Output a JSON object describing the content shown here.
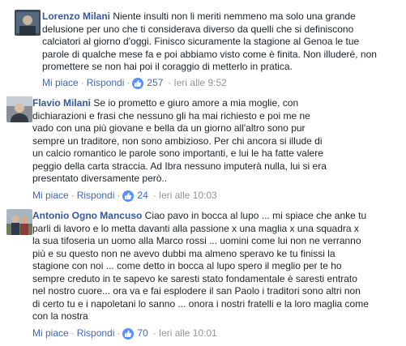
{
  "comments": [
    {
      "author": "Lorenzo Milani",
      "lines": [
        " Niente insulti non li meriti nemmeno ma solo una grande",
        "delusione per uno che ti considerava diverso da quelli che si definiscono",
        "calciatori al giorno d'oggi. Finisco sicuramente la stagione al Genoa le tue",
        "parole di qualche mese fa e poi abbiamo visto come è finita. Non illuderé, non",
        "promettere se non hai poi il coraggio di metterlo in pratica."
      ],
      "like_label": "Mi piace",
      "reply_label": "Rispondi",
      "reactions": "257",
      "time": "Ieri alle 9:52"
    },
    {
      "author": "Flavio Milani",
      "lines": [
        " Se io prometto e giuro amore a mia moglie, con",
        "dichiarazioni e frasi che nessuno gli ha mai richiesto e poi me ne",
        "vado con una più giovane e bella da un giorno all'altro sono pur",
        "sempre un traditore, non sono ambizioso. Per chi ancora si illude di",
        "un calcio romantico le parole sono importanti, e lui le ha fatte valere",
        "peggio della carta straccia. Ad Ibra nessuno imputerà nulla, lui si era",
        "presentato diversamente però.."
      ],
      "like_label": "Mi piace",
      "reply_label": "Rispondi",
      "reactions": "24",
      "time": "Ieri alle 10:03"
    },
    {
      "author": "Antonio Ogno Mancuso",
      "lines": [
        " Ciao pavo in bocca al lupo ... mi spiace che anke tu",
        "parli di lavoro e lo metta davanti alla passione x una maglia x una squadra x",
        "la sua tifoseria un uomo alla Marco rossi ... uomini come lui non ne verranno",
        "più e su questo non ne avevo dubbi ma almeno speravo ke tu finissi la",
        "stagione con noi ... come detto in bocca al lupo spero il meglio per te ho",
        "sempre creduto in te sapevo ke saresti stato fondamentale è saresti entrato",
        "nel nostro cuore... ora va e fai esplodere il san Paolo i traditori sono altri non",
        "di certo tu e i napoletani lo sanno ... onora i nostri fratelli e la loro maglia come",
        "con la nostra"
      ],
      "like_label": "Mi piace",
      "reply_label": "Rispondi",
      "reactions": "70",
      "time": "Ieri alle 10:01"
    }
  ],
  "colors": {
    "author": "#365899",
    "link": "#4267b2",
    "meta": "#90949c",
    "like_icon": "#5890ff"
  },
  "icons": [
    "avatar",
    "like-icon"
  ]
}
